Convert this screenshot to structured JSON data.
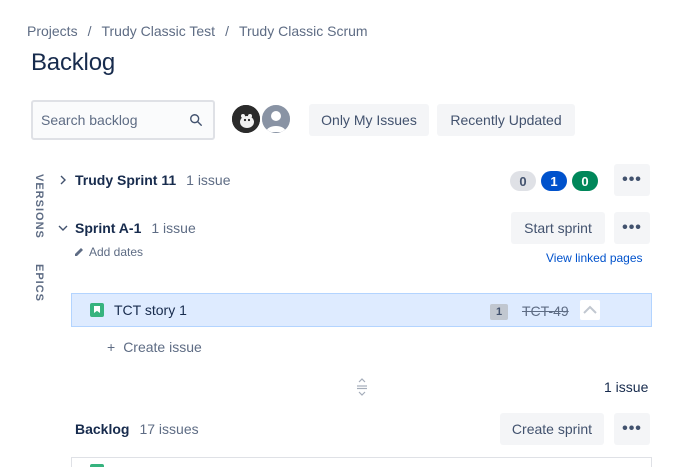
{
  "breadcrumb": {
    "items": [
      "Projects",
      "Trudy Classic Test",
      "Trudy Classic Scrum"
    ],
    "separator": "/"
  },
  "page": {
    "title": "Backlog"
  },
  "search": {
    "placeholder": "Search backlog",
    "value": ""
  },
  "avatars": [
    {
      "icon": "user-avatar-photo"
    },
    {
      "icon": "user-avatar-default"
    }
  ],
  "filters": {
    "only_my_issues": "Only My Issues",
    "recently_updated": "Recently Updated"
  },
  "side_tabs": {
    "versions": "VERSIONS",
    "epics": "EPICS"
  },
  "sprints": [
    {
      "name": "Trudy Sprint 11",
      "count": "1 issue",
      "expanded": false,
      "status_counts": {
        "todo": "0",
        "in_progress": "1",
        "done": "0"
      },
      "more": "•••"
    },
    {
      "name": "Sprint A-1",
      "count": "1 issue",
      "expanded": true,
      "add_dates": "Add dates",
      "start_button": "Start sprint",
      "view_linked": "View linked pages",
      "more": "•••",
      "issues": [
        {
          "summary": "TCT story 1",
          "type_icon": "story-icon",
          "estimate": "1",
          "key": "TCT-49",
          "key_struck": true,
          "priority_icon": "priority-high-icon"
        }
      ],
      "create_issue": "Create issue",
      "total": "1 issue"
    }
  ],
  "backlog": {
    "name": "Backlog",
    "count": "17 issues",
    "create_sprint": "Create sprint",
    "more": "•••"
  },
  "colors": {
    "accent": "#0052cc",
    "done": "#00875a",
    "story": "#36b37e",
    "selected_row": "#deebff"
  }
}
